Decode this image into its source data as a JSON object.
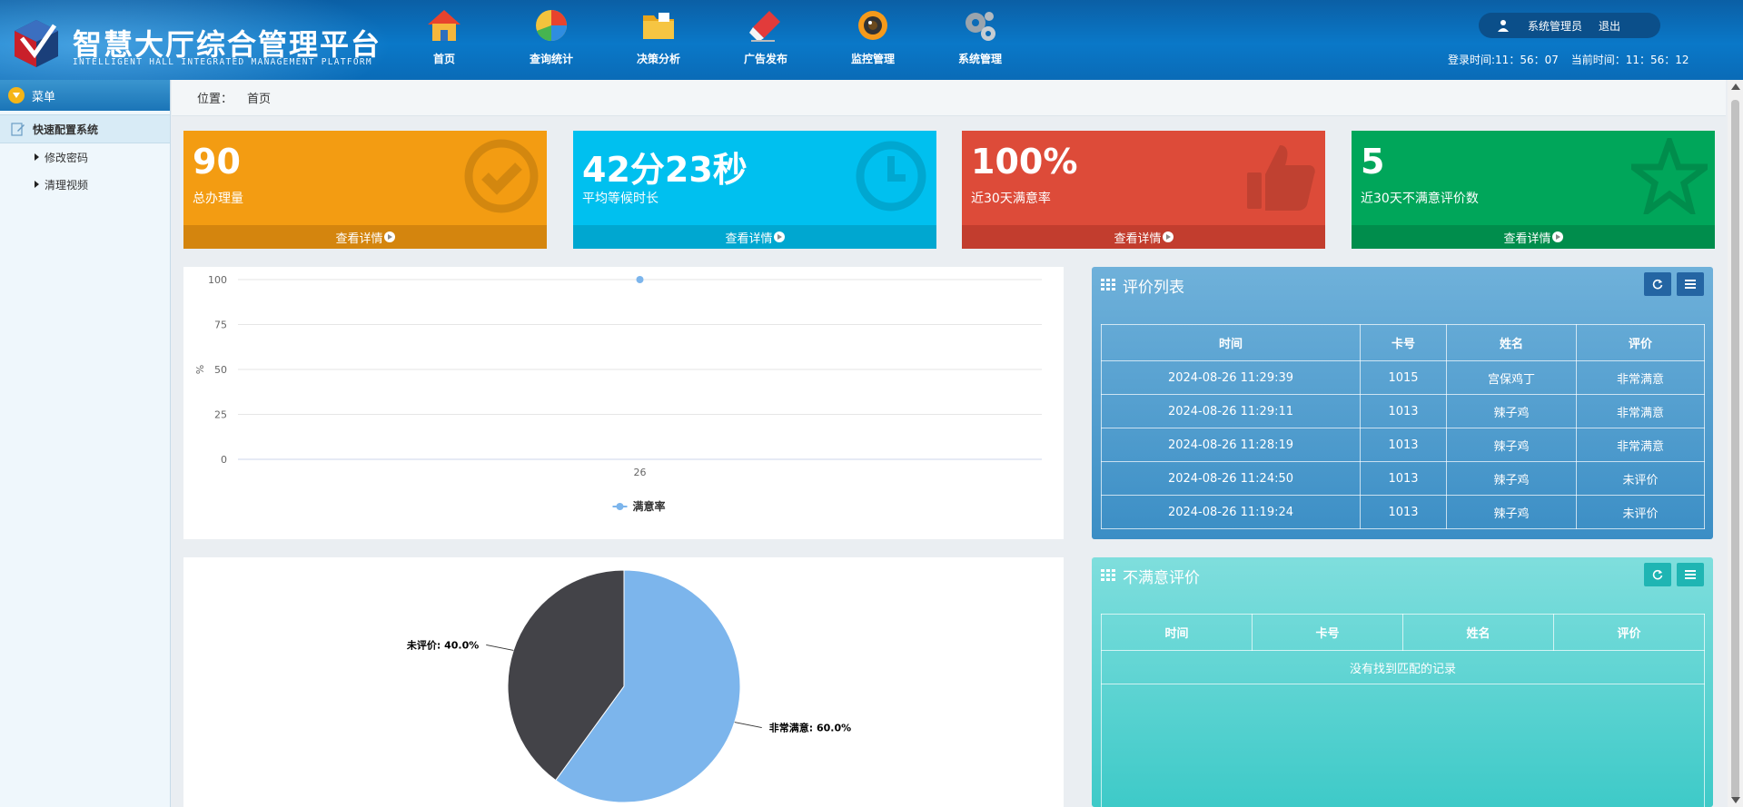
{
  "header": {
    "title": "智慧大厅综合管理平台",
    "subtitle": "INTELLIGENT HALL INTEGRATED MANAGEMENT PLATFORM",
    "nav": [
      {
        "label": "首页",
        "icon": "home-icon"
      },
      {
        "label": "查询统计",
        "icon": "pie-chart-icon"
      },
      {
        "label": "决策分析",
        "icon": "folder-icon"
      },
      {
        "label": "广告发布",
        "icon": "eraser-icon"
      },
      {
        "label": "监控管理",
        "icon": "camera-icon"
      },
      {
        "label": "系统管理",
        "icon": "gears-icon"
      }
    ],
    "user": "系统管理员",
    "logout": "退出",
    "login_time": "登录时间:11：56：07",
    "current_time": "当前时间：11：56：12"
  },
  "sidebar": {
    "menu_title": "菜单",
    "section": "快速配置系统",
    "items": [
      {
        "label": "修改密码"
      },
      {
        "label": "清理视频"
      }
    ]
  },
  "breadcrumb": {
    "label": "位置：",
    "current": "首页"
  },
  "stats": [
    {
      "value": "90",
      "label": "总办理量",
      "link": "查看详情",
      "color": "#f39c12",
      "footer_color": "#d4850e",
      "icon": "check-circle-icon"
    },
    {
      "value": "42分23秒",
      "label": "平均等候时长",
      "link": "查看详情",
      "color": "#00c0ef",
      "footer_color": "#00a7d0",
      "icon": "clock-icon"
    },
    {
      "value": "100%",
      "label": "近30天满意率",
      "link": "查看详情",
      "color": "#dd4b39",
      "footer_color": "#c23d2e",
      "icon": "thumbs-up-icon"
    },
    {
      "value": "5",
      "label": "近30天不满意评价数",
      "link": "查看详情",
      "color": "#00a65a",
      "footer_color": "#008d4c",
      "icon": "star-icon"
    }
  ],
  "chart_data": [
    {
      "type": "line",
      "x": [
        "26"
      ],
      "series": [
        {
          "name": "满意率",
          "values": [
            100
          ]
        }
      ],
      "ylabel": "%",
      "ylim": [
        0,
        100
      ],
      "yticks": [
        "0",
        "25",
        "50",
        "75",
        "100"
      ],
      "grid": true,
      "legend": "bottom",
      "color": "#7cb5ec"
    },
    {
      "type": "pie",
      "slices": [
        {
          "name": "非常满意",
          "value": 60.0,
          "label": "非常满意: 60.0%",
          "color": "#7cb5ec"
        },
        {
          "name": "未评价",
          "value": 40.0,
          "label": "未评价: 40.0%",
          "color": "#434348"
        }
      ]
    }
  ],
  "eval_list": {
    "title": "评价列表",
    "columns": [
      "时间",
      "卡号",
      "姓名",
      "评价"
    ],
    "rows": [
      [
        "2024-08-26 11:29:39",
        "1015",
        "宫保鸡丁",
        "非常满意"
      ],
      [
        "2024-08-26 11:29:11",
        "1013",
        "辣子鸡",
        "非常满意"
      ],
      [
        "2024-08-26 11:28:19",
        "1013",
        "辣子鸡",
        "非常满意"
      ],
      [
        "2024-08-26 11:24:50",
        "1013",
        "辣子鸡",
        "未评价"
      ],
      [
        "2024-08-26 11:19:24",
        "1013",
        "辣子鸡",
        "未评价"
      ]
    ]
  },
  "unsat": {
    "title": "不满意评价",
    "columns": [
      "时间",
      "卡号",
      "姓名",
      "评价"
    ],
    "empty": "没有找到匹配的记录"
  }
}
